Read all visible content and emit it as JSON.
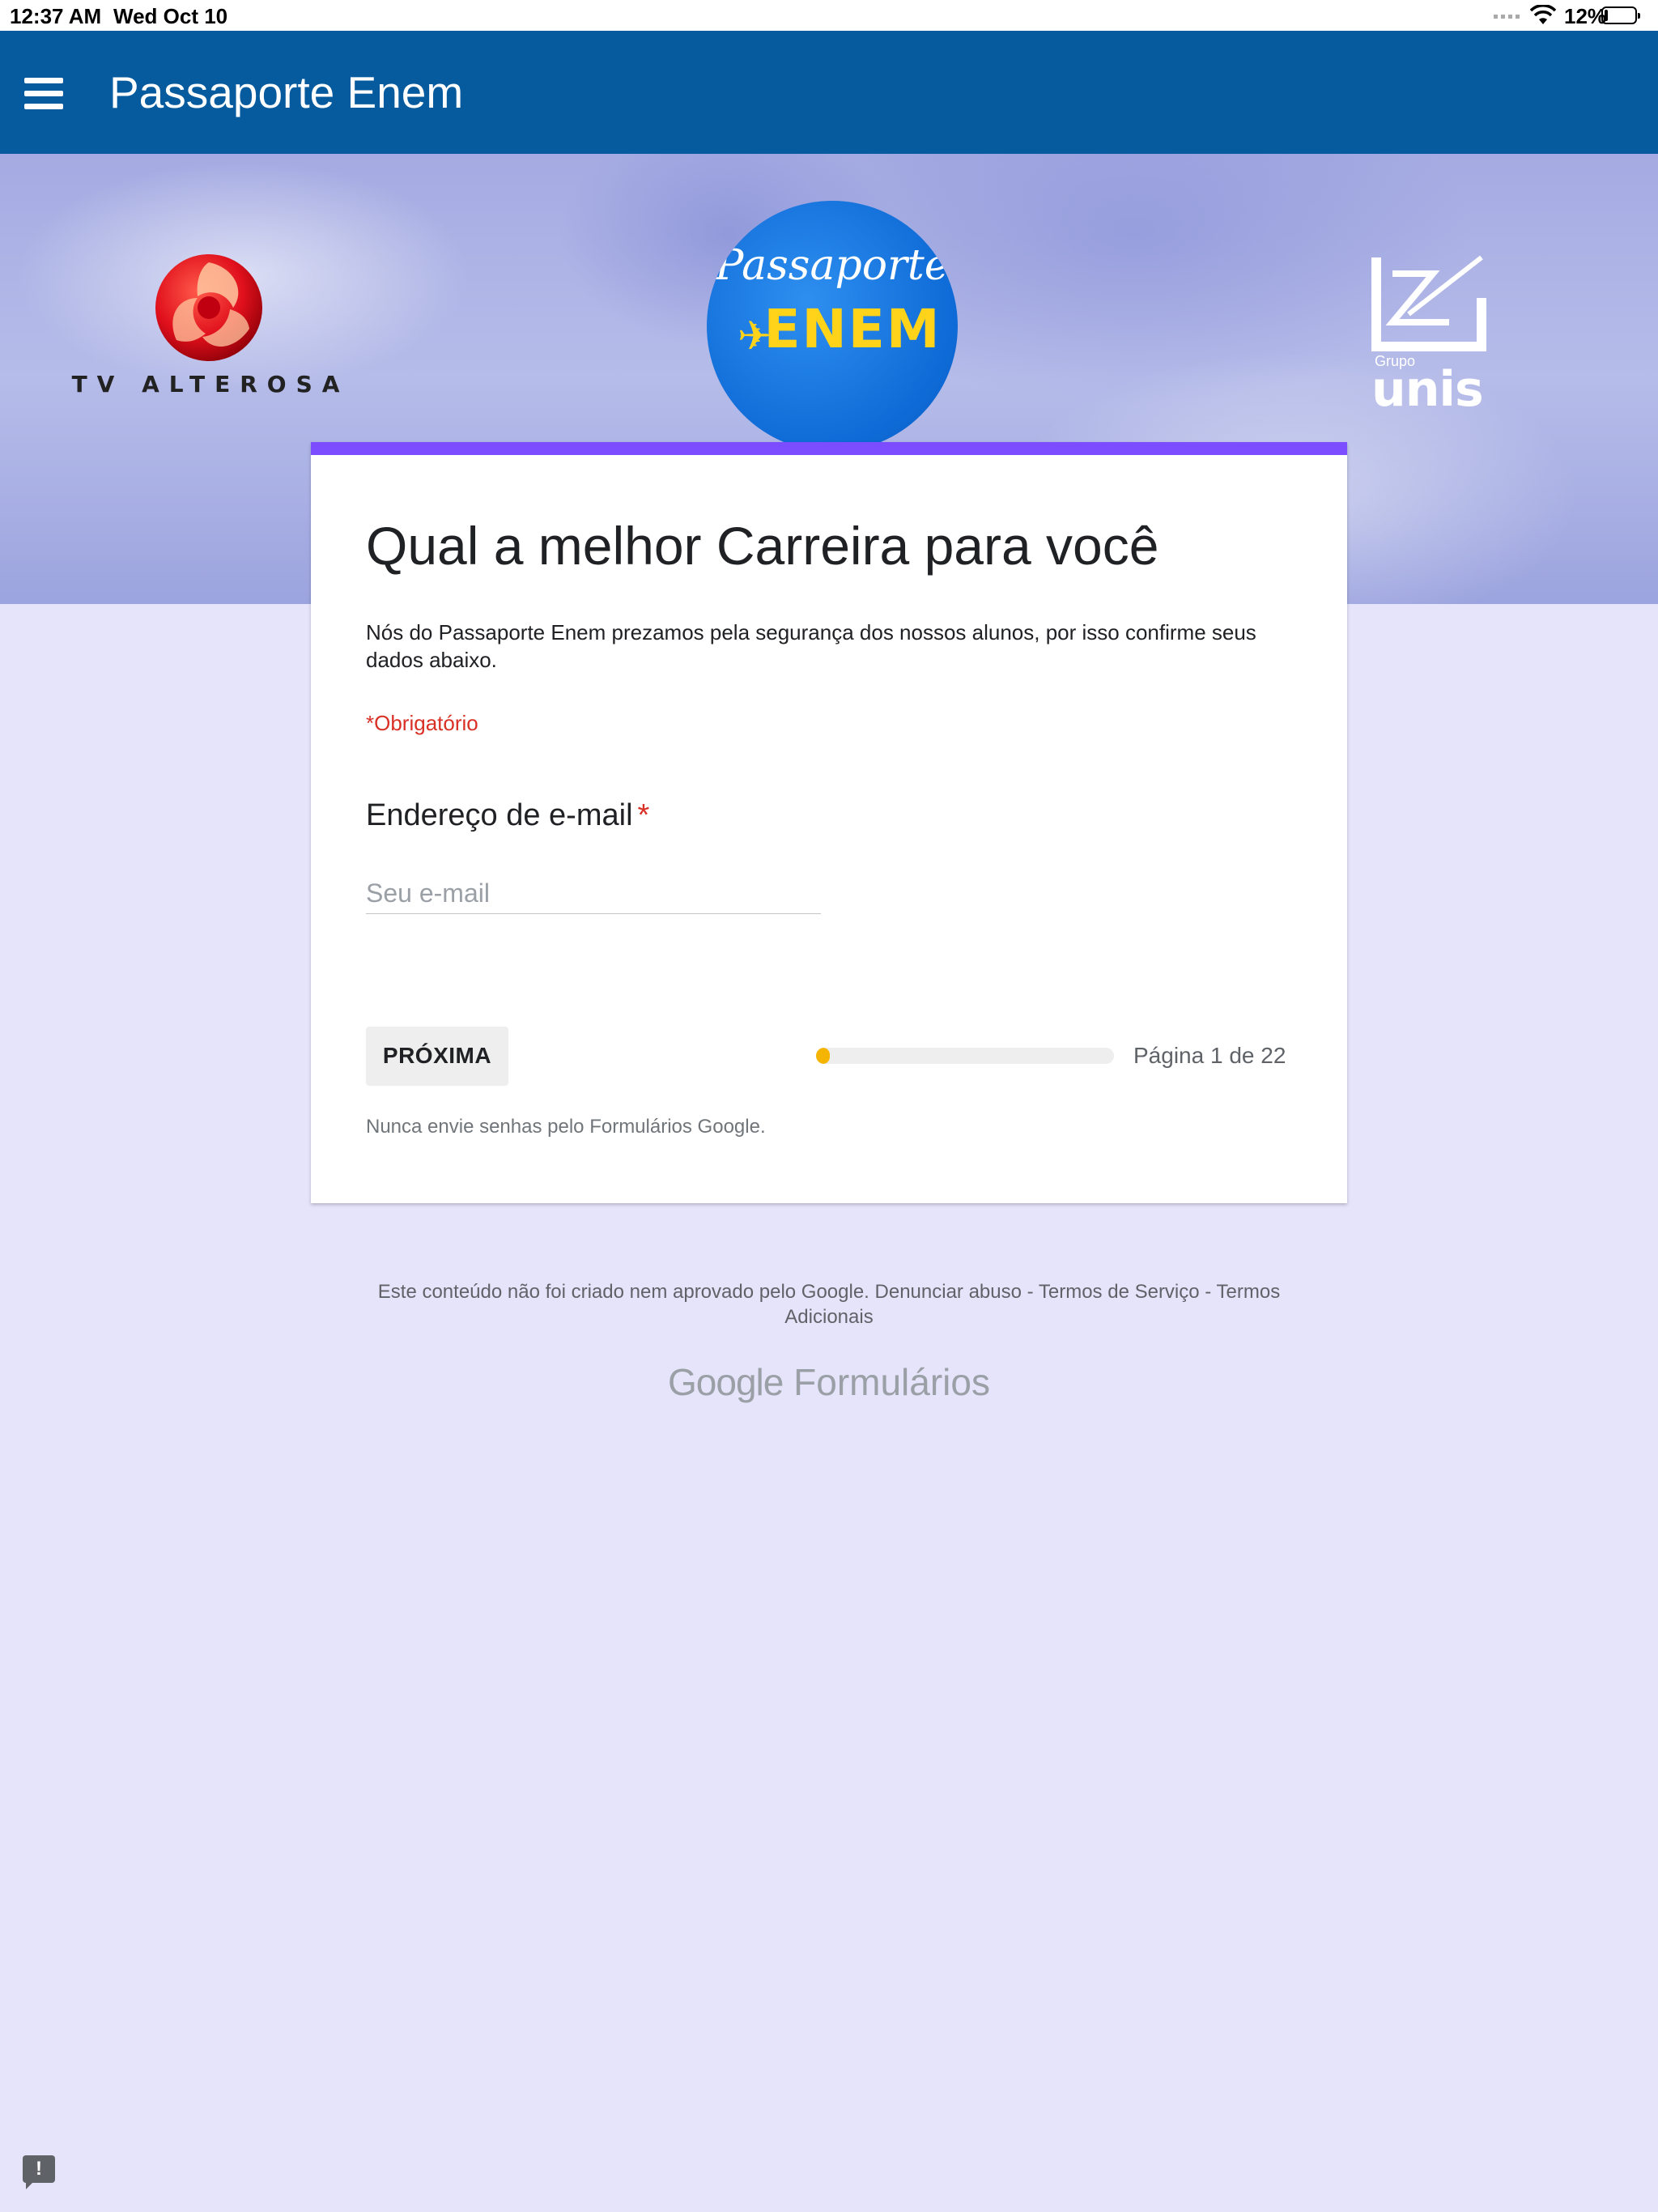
{
  "status_bar": {
    "time": "12:37 AM",
    "date": "Wed Oct 10",
    "battery": "12%",
    "battery_level": 0.12
  },
  "app_bar": {
    "title": "Passaporte Enem"
  },
  "banner": {
    "left_logo_text": "TV ALTEROSA",
    "center_logo_line1": "Passaporte",
    "center_logo_line2": "ENEM",
    "right_logo_small": "Grupo",
    "right_logo_big": "unis"
  },
  "form": {
    "title": "Qual a melhor Carreira para você",
    "description": "Nós do Passaporte Enem  prezamos pela segurança dos  nossos alunos,  por isso confirme seus dados abaixo.",
    "required_note": "*Obrigatório",
    "question": {
      "label": "Endereço de e-mail",
      "required_marker": "*",
      "placeholder": "Seu e-mail",
      "value": ""
    },
    "next_button": "PRÓXIMA",
    "progress": {
      "current_page": 1,
      "total_pages": 22,
      "fraction": 0.045,
      "label": "Página 1 de 22"
    },
    "password_warning": "Nunca envie senhas pelo Formulários Google."
  },
  "footer": {
    "disclaimer": "Este conteúdo não foi criado nem aprovado pelo Google.",
    "report_link": "Denunciar abuso",
    "sep1": "-",
    "terms_link": "Termos de Serviço",
    "sep2": "-",
    "additional_link": "Termos Adicionais",
    "brand_google": "Google",
    "brand_product": "Formulários"
  },
  "feedback_button": "!",
  "colors": {
    "app_bar": "#065a9e",
    "accent": "#7c4dff",
    "page_background": "#e6e4fb",
    "required": "#d93025",
    "progress_fill": "#f4b400"
  },
  "icons": {
    "menu": "hamburger-menu-icon",
    "wifi": "wifi-icon",
    "battery": "battery-icon",
    "signal": "signal-icon",
    "feedback": "feedback-icon"
  }
}
